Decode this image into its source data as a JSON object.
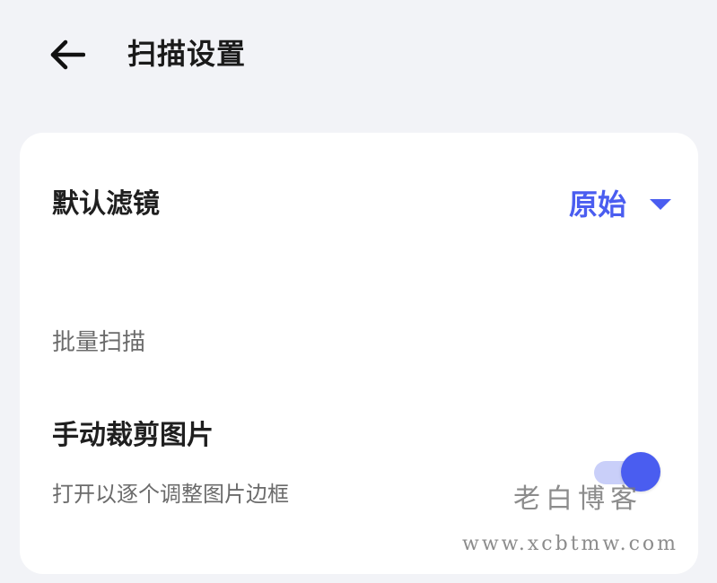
{
  "header": {
    "back_icon": "arrow-left-icon",
    "title": "扫描设置"
  },
  "settings": {
    "default_filter": {
      "label": "默认滤镜",
      "value": "原始",
      "dropdown_icon": "caret-down-icon"
    },
    "batch_section": {
      "label": "批量扫描"
    },
    "manual_crop": {
      "title": "手动裁剪图片",
      "description": "打开以逐个调整图片边框",
      "enabled": true
    }
  },
  "watermark": {
    "name": "老白博客",
    "url": "www.xcbtmw.com"
  },
  "colors": {
    "accent": "#4a5df0",
    "toggle_track": "#c9cff9",
    "background": "#f2f3f7",
    "card": "#ffffff"
  }
}
